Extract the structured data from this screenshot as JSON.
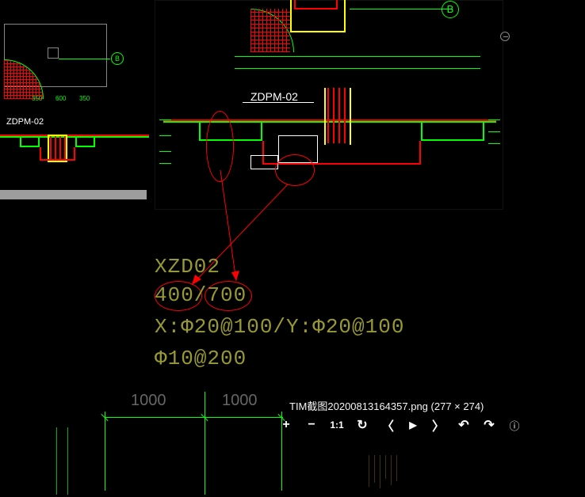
{
  "thumbnail": {
    "label": "ZDPM-02",
    "circle_b": "B",
    "dim_top1": "350",
    "dim_top2": "600",
    "dim_top3": "350"
  },
  "main_drawing": {
    "label": "ZDPM-02",
    "circle_b": "B"
  },
  "annotations": {
    "line1": "XZD02",
    "line2": "400/700",
    "line3": "X:Φ20@100/Y:Φ20@100",
    "line4": "Φ10@200"
  },
  "dimensions": {
    "d1": "1000",
    "d2": "1000"
  },
  "statusbar": {
    "filename": "TIM截图20200813164357.png",
    "size": "(277 × 274)"
  },
  "toolbar": {
    "zoom_in": "+",
    "zoom_out": "−",
    "fit": "1:1",
    "rotate": "↻",
    "prev": "〈",
    "play": "▶",
    "next": "〉",
    "undo": "↶",
    "redo": "↷",
    "info": "ⓘ"
  }
}
